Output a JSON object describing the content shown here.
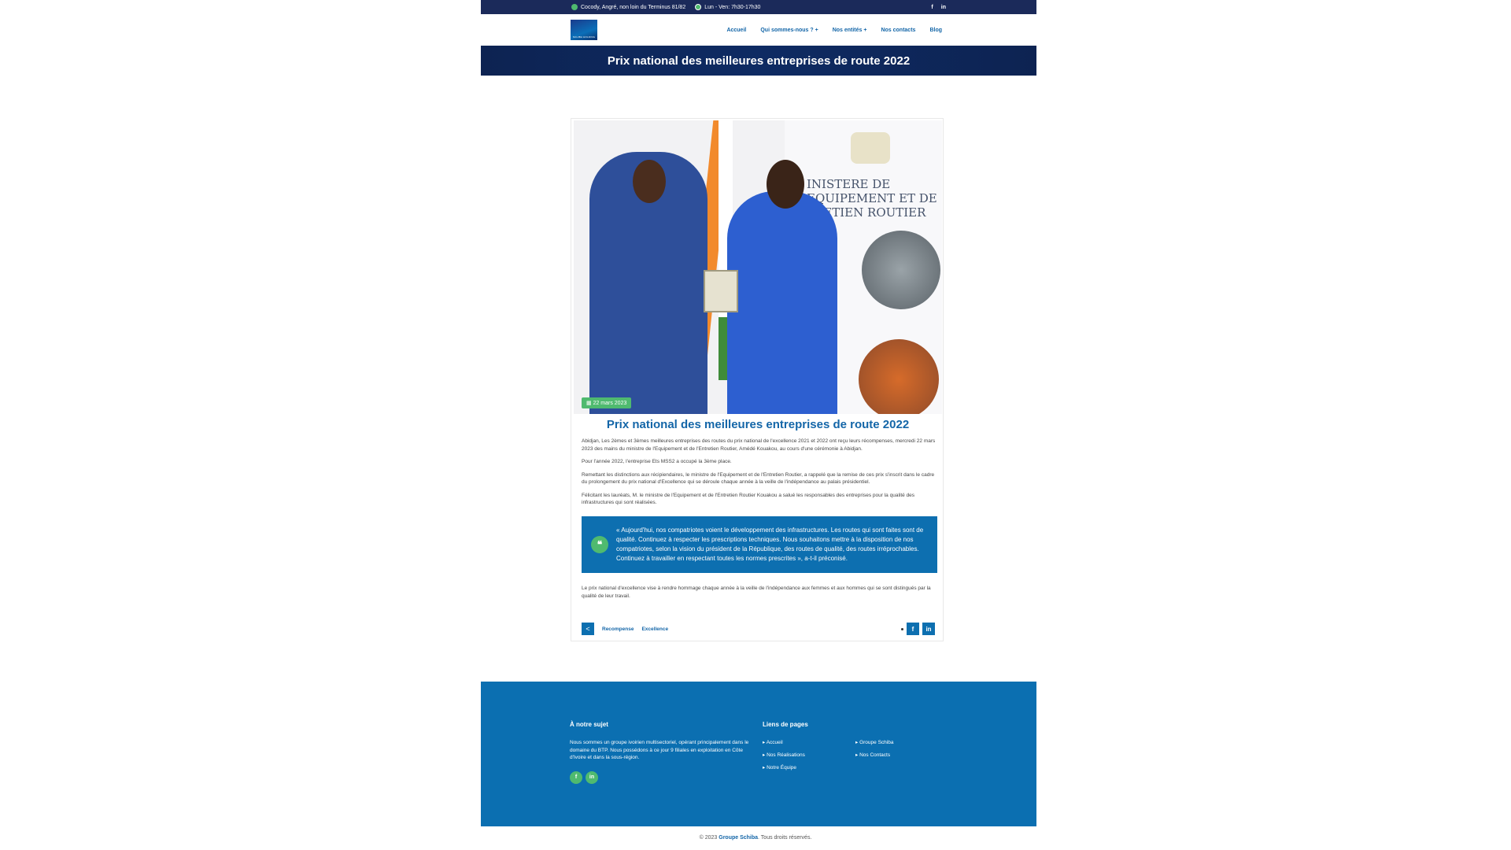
{
  "topbar": {
    "address": "Cocody, Angré, non loin du Terminus 81/82",
    "hours": "Lun - Ven: 7h30-17h30",
    "facebook": "f",
    "linkedin": "in"
  },
  "nav": {
    "logo_text": "SCHIBA HOLDING",
    "items": [
      "Accueil",
      "Qui sommes-nous ?",
      "Nos entités",
      "Nos contacts",
      "Blog"
    ]
  },
  "hero": {
    "title": "Prix national des meilleures entreprises de route 2022"
  },
  "article": {
    "ministry_sign": "INISTERE DE EQUIPEMENT ET DE TRETIEN ROUTIER",
    "date": "22 mars 2023",
    "title": "Prix national des meilleures entreprises de route 2022",
    "paragraphs": [
      "Abidjan, Les 2èmes et 3èmes meilleures entreprises des routes du prix national de l'excellence 2021 et 2022 ont reçu leurs récompenses, mercredi 22 mars 2023 des mains du ministre de l'Equipement et de l'Entretien Routier, Amédé Kouakou, au cours d'une cérémonie à Abidjan.",
      "Pour l'année 2022, l'entreprise Ets MSS2 a occupé la 3ème place.",
      "Remettant les distinctions aux récipiendaires, le ministre de l'Equipement et de l'Entretien Routier, a rappelé que la remise de ces prix s'inscrit dans le cadre du prolongement du prix national d'Excellence qui se déroule chaque année à la veille de l'indépendance au palais présidentiel.",
      "Félicitant les lauréats, M. le ministre de l'Equipement et de l'Entretien Routier Kouakou a salué les responsables des entreprises pour la qualité des infrastructures qui sont réalisées."
    ],
    "quote_mark": "❝",
    "quote": "« Aujourd'hui, nos compatriotes voient le développement des infrastructures. Les routes qui sont faites sont de qualité. Continuez à respecter les prescriptions techniques. Nous souhaitons mettre à la disposition de nos compatriotes, selon la vision du président de la République, des routes de qualité, des routes irréprochables. Continuez à travailler en respectant toutes les normes prescrites », a-t-il préconisé.",
    "closing": "Le prix national d'excellence vise à rendre hommage chaque année à la veille de l'indépendance aux femmes et aux hommes qui se sont distingués par la qualité de leur travail.",
    "tags": [
      "Recompense",
      "Excellence"
    ],
    "share_facebook": "f",
    "share_linkedin": "in"
  },
  "footer": {
    "about_title": "À notre sujet",
    "about_text": "Nous sommes un groupe ivoirien multisectoriel, opérant principalement dans le domaine du BTP. Nous possédons à ce jour 9 filiales en exploitation en Côte d'Ivoire et dans la sous-région.",
    "social_facebook": "f",
    "social_linkedin": "in",
    "links_title": "Liens de pages",
    "links": [
      "Accueil",
      "Groupe Schiba",
      "Nos Réalisations",
      "Nos Contacts",
      "Notre Équipe"
    ]
  },
  "copyright": {
    "prefix": "© 2023",
    "brand": "Groupe Schiba",
    "suffix": ". Tous droits réservés."
  },
  "colors": {
    "navy": "#1b2a5a",
    "blue": "#0d6fb0",
    "green": "#4fba6f",
    "link": "#1466a8"
  }
}
